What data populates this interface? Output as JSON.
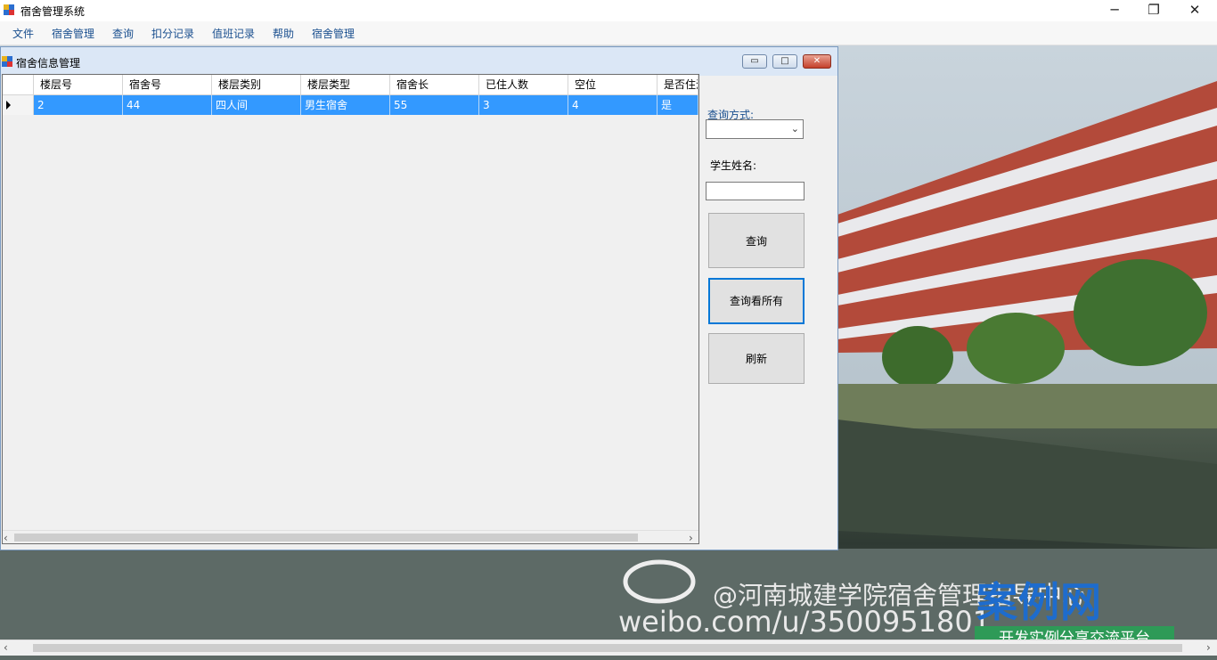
{
  "app": {
    "title": "宿舍管理系统",
    "window_controls": {
      "minimize": "─",
      "restore": "❐",
      "close": "✕"
    }
  },
  "menu": [
    "文件",
    "宿舍管理",
    "查询",
    "扣分记录",
    "值班记录",
    "帮助",
    "宿舍管理"
  ],
  "child_window": {
    "title": "宿舍信息管理",
    "controls": {
      "minimize": "▭",
      "restore": "□",
      "close": "✕"
    }
  },
  "grid": {
    "columns": [
      "楼层号",
      "宿舍号",
      "楼层类别",
      "楼层类型",
      "宿舍长",
      "已住人数",
      "空位",
      "是否住满"
    ],
    "rows": [
      [
        "2",
        "44",
        "四人间",
        "男生宿舍",
        "55",
        "3",
        "4",
        "是"
      ]
    ]
  },
  "side_panel": {
    "query_mode_label": "查询方式:",
    "query_mode_value": "",
    "student_name_label": "学生姓名:",
    "student_name_value": "",
    "query_button": "查询",
    "query_all_button": "查询看所有",
    "refresh_button": "刷新"
  },
  "background": {
    "weibo_line1": "@河南城建学院宿舍管理指导中心",
    "weibo_line2": "weibo.com/u/3500951801",
    "brand": "案例网",
    "brand_tagline": "开发实例分享交流平台"
  },
  "colors": {
    "selection": "#3399ff",
    "menu_text": "#1a4f8f",
    "focus_border": "#0078d7"
  }
}
